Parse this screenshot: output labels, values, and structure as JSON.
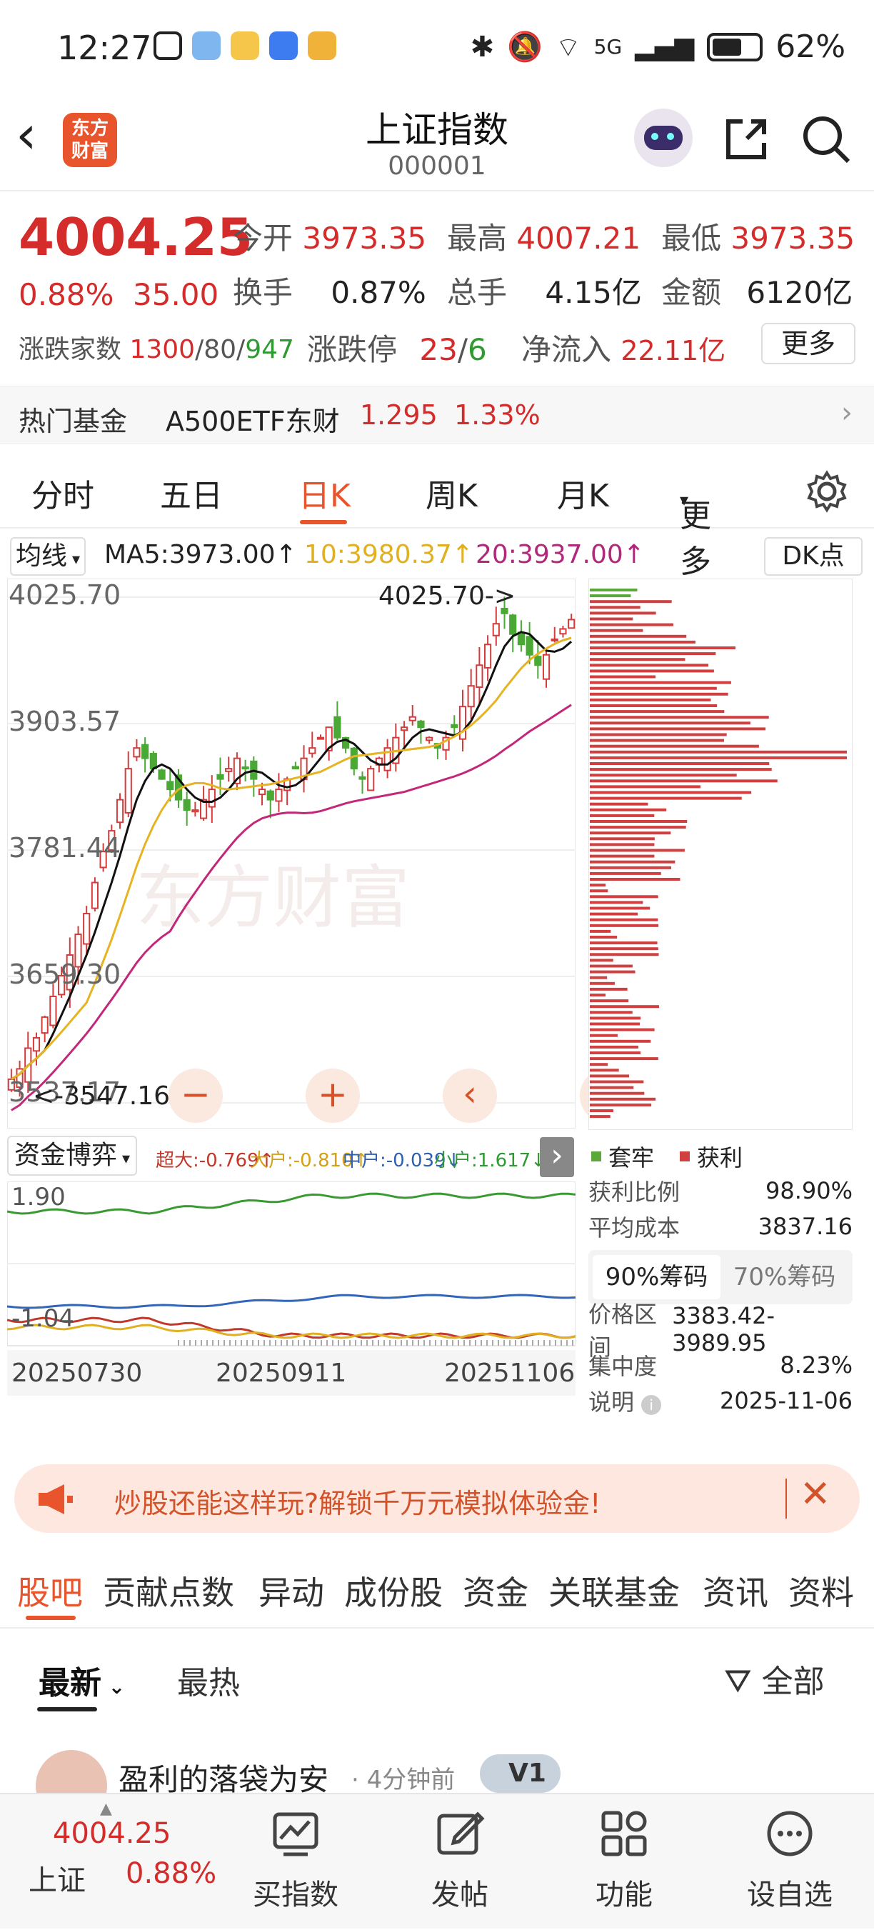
{
  "status_bar": {
    "time": "12:27",
    "network": "5G",
    "battery": "62%"
  },
  "header": {
    "title": "上证指数",
    "code": "000001",
    "logo_text_1": "东方",
    "logo_text_2": "财富"
  },
  "quote": {
    "price": "4004.25",
    "change_pct": "0.88%",
    "change": "35.00",
    "open_label": "今开",
    "open": "3973.35",
    "high_label": "最高",
    "high": "4007.21",
    "low_label": "最低",
    "low": "3973.35",
    "turnover_label": "换手",
    "turnover": "0.87%",
    "volume_label": "总手",
    "volume": "4.15亿",
    "amount_label": "金额",
    "amount": "6120亿",
    "advdec_label": "涨跌家数",
    "adv": "1300",
    "flat": "80",
    "dec": "947",
    "limit_label": "涨跌停",
    "limit_up": "23",
    "limit_down": "6",
    "inflow_label": "净流入",
    "inflow": "22.11亿",
    "more_button": "更多"
  },
  "fund": {
    "label": "热门基金",
    "name": "A500ETF东财",
    "price": "1.295",
    "pct": "1.33%"
  },
  "k_tabs": [
    "分时",
    "五日",
    "日K",
    "周K",
    "月K",
    "更多"
  ],
  "k_tab_active": "日K",
  "ma": {
    "select": "均线",
    "ma5": "MA5:3973.00↑",
    "ma10": "10:3980.37↑",
    "ma20": "20:3937.00↑",
    "dk": "DK点"
  },
  "chart_data": {
    "type": "candlestick",
    "y_ticks": [
      "4025.70",
      "3903.57",
      "3781.44",
      "3659.30",
      "3537.17"
    ],
    "max_label": "4025.70->",
    "min_label": "<-3547.16",
    "ylim": [
      3537.17,
      4025.7
    ],
    "x_ticks": [
      "20250730",
      "20250911",
      "20251106"
    ]
  },
  "funds_game": {
    "select": "资金博弈",
    "super": "超大:-0.769↑",
    "big": "大户:-0.810↑",
    "mid": "中户:-0.039↓",
    "small": "小户:1.617↓",
    "y_top": "1.90",
    "y_bottom": "-1.04",
    "chart_data": {
      "type": "line",
      "ylim": [
        -1.04,
        1.9
      ]
    }
  },
  "chip": {
    "legend_loss": "套牢",
    "legend_profit": "获利",
    "profit_ratio_label": "获利比例",
    "profit_ratio": "98.90%",
    "avg_cost_label": "平均成本",
    "avg_cost": "3837.16",
    "tab90": "90%筹码",
    "tab70": "70%筹码",
    "range_label": "价格区间",
    "range": "3383.42-3989.95",
    "conc_label": "集中度",
    "conc": "8.23%",
    "note_label": "说明",
    "note_date": "2025-11-06"
  },
  "ad": {
    "text": "炒股还能这样玩?解锁千万元模拟体验金!"
  },
  "bottom_tabs": [
    "股吧",
    "贡献点数",
    "异动",
    "成份股",
    "资金",
    "关联基金",
    "资讯",
    "资料"
  ],
  "sub_tabs": {
    "latest": "最新",
    "hot": "最热",
    "filter": "全部"
  },
  "post": {
    "user": "盈利的落袋为安",
    "time": "· 4分钟前",
    "level": "V1"
  },
  "bottom_bar": {
    "index_price": "4004.25",
    "index_name": "上证",
    "index_pct": "0.88%",
    "buy": "买指数",
    "post": "发帖",
    "func": "功能",
    "watch": "设自选"
  }
}
